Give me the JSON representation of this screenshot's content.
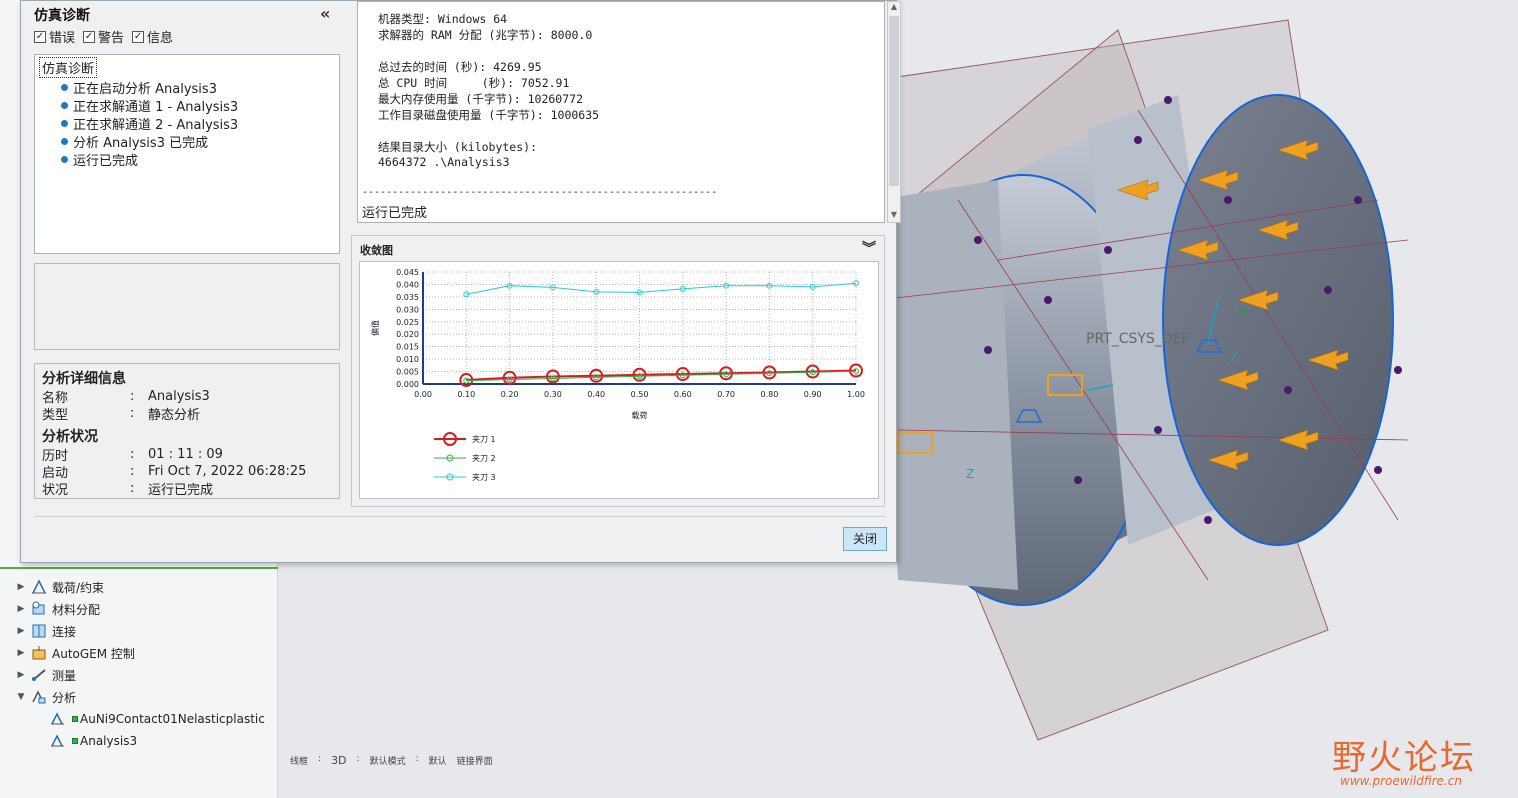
{
  "dialog": {
    "title": "仿真诊断",
    "filters": [
      {
        "label": "错误",
        "checked": true
      },
      {
        "label": "警告",
        "checked": true
      },
      {
        "label": "信息",
        "checked": true
      }
    ],
    "tree_root": "仿真诊断",
    "tree_items": [
      "正在启动分析 Analysis3",
      "正在求解通道 1 - Analysis3",
      "正在求解通道 2 - Analysis3",
      "分析 Analysis3 已完成",
      "运行已完成"
    ],
    "details": {
      "heading1": "分析详细信息",
      "name_label": "名称",
      "name_value": "Analysis3",
      "type_label": "类型",
      "type_value": "静态分析",
      "heading2": "分析状况",
      "elapsed_label": "历时",
      "elapsed_value": "01 : 11 : 09",
      "start_label": "启动",
      "start_value": "Fri Oct  7, 2022   06:28:25",
      "status_label": "状况",
      "status_value": "运行已完成",
      "colon": ":"
    },
    "log_lines": [
      "机器类型: Windows 64",
      "求解器的 RAM 分配 (兆字节): 8000.0",
      "总过去的时间 (秒): 4269.95",
      "总 CPU 时间     (秒): 7052.91",
      "最大内存使用量 (千字节): 10260772",
      "工作目录磁盘使用量 (千字节): 1000635",
      "结果目录大小 (kilobytes):",
      "4664372 .\\Analysis3",
      "-----------------------------------------------------------",
      "运行已完成"
    ],
    "convergence_title": "收敛图",
    "close_label": "关闭"
  },
  "chart_data": {
    "type": "line",
    "title": "",
    "xlabel": "载荷",
    "ylabel": "偏值",
    "x": [
      0.1,
      0.2,
      0.3,
      0.4,
      0.5,
      0.6,
      0.7,
      0.8,
      0.9,
      1.0
    ],
    "xlim": [
      0.0,
      1.0
    ],
    "ylim": [
      0.0,
      0.045
    ],
    "xticks": [
      "0.00",
      "0.10",
      "0.20",
      "0.30",
      "0.40",
      "0.50",
      "0.60",
      "0.70",
      "0.80",
      "0.90",
      "1.00"
    ],
    "yticks": [
      "0.000",
      "0.005",
      "0.010",
      "0.015",
      "0.020",
      "0.025",
      "0.030",
      "0.035",
      "0.040",
      "0.045"
    ],
    "grid": true,
    "legend_position": "bottom-left",
    "series": [
      {
        "name": "夹刀 1",
        "color": "#d22020",
        "values": [
          0.0016,
          0.0025,
          0.003,
          0.0033,
          0.0037,
          0.004,
          0.0043,
          0.0046,
          0.005,
          0.0054
        ]
      },
      {
        "name": "夹刀 2",
        "color": "#33b24a",
        "values": [
          0.0013,
          0.0018,
          0.0022,
          0.0027,
          0.0031,
          0.0035,
          0.0039,
          0.0043,
          0.0047,
          0.0051
        ]
      },
      {
        "name": "夹刀 3",
        "color": "#2ec8d6",
        "values": [
          0.036,
          0.0395,
          0.0388,
          0.037,
          0.0368,
          0.0382,
          0.0395,
          0.0395,
          0.039,
          0.0405
        ]
      }
    ]
  },
  "tree": {
    "items": [
      {
        "label": "载荷/约束",
        "icon": "load-constraint-icon",
        "expandable": true
      },
      {
        "label": "材料分配",
        "icon": "material-assign-icon",
        "expandable": true
      },
      {
        "label": "连接",
        "icon": "connection-icon",
        "expandable": true
      },
      {
        "label": "AutoGEM 控制",
        "icon": "autogem-icon",
        "expandable": true
      },
      {
        "label": "测量",
        "icon": "measure-icon",
        "expandable": true
      },
      {
        "label": "分析",
        "icon": "analysis-icon",
        "expandable": true,
        "expanded": true
      }
    ],
    "children": [
      {
        "label": "AuNi9Contact01Nelasticplastic",
        "icon": "analysis-run-icon"
      },
      {
        "label": "Analysis3",
        "icon": "analysis-run-icon"
      }
    ]
  },
  "statusbar": [
    "线框",
    ":",
    "3D",
    ":",
    "默认模式",
    ":",
    "默认",
    "链接界面"
  ],
  "viewport": {
    "csys_label": "PRT_CSYS_DEF",
    "z_label": "Z",
    "y_label": "Y",
    "x_label": "X"
  },
  "watermark": {
    "title": "野火论坛",
    "url": "www.proewildfire.cn"
  }
}
